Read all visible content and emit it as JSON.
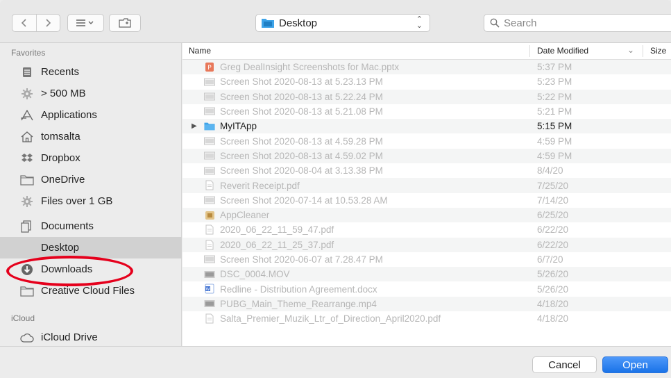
{
  "toolbar": {
    "location": "Desktop",
    "search_placeholder": "Search"
  },
  "sidebar": {
    "favorites_heading": "Favorites",
    "icloud_heading": "iCloud",
    "items": [
      {
        "label": "Recents",
        "icon": "recents-icon"
      },
      {
        "label": "> 500 MB",
        "icon": "gear-icon"
      },
      {
        "label": "Applications",
        "icon": "applications-icon"
      },
      {
        "label": "tomsalta",
        "icon": "home-icon"
      },
      {
        "label": "Dropbox",
        "icon": "dropbox-icon"
      },
      {
        "label": "OneDrive",
        "icon": "folder-icon"
      },
      {
        "label": "Files over 1 GB",
        "icon": "gear-icon"
      },
      {
        "label": "Documents",
        "icon": "documents-icon"
      },
      {
        "label": "Desktop",
        "icon": "desktop-icon"
      },
      {
        "label": "Downloads",
        "icon": "downloads-icon"
      },
      {
        "label": "Creative Cloud Files",
        "icon": "folder-icon"
      }
    ],
    "icloud_items": [
      {
        "label": "iCloud Drive",
        "icon": "cloud-icon"
      }
    ]
  },
  "columns": {
    "name": "Name",
    "date": "Date Modified",
    "size": "Size"
  },
  "files": [
    {
      "name": "Greg DealInsight Screenshots for Mac.pptx",
      "date": "5:37 PM",
      "icon": "pptx-icon"
    },
    {
      "name": "Screen Shot 2020-08-13 at 5.23.13 PM",
      "date": "5:23 PM",
      "icon": "image-icon"
    },
    {
      "name": "Screen Shot 2020-08-13 at 5.22.24 PM",
      "date": "5:22 PM",
      "icon": "image-icon"
    },
    {
      "name": "Screen Shot 2020-08-13 at 5.21.08 PM",
      "date": "5:21 PM",
      "icon": "image-icon"
    },
    {
      "name": "MyITApp",
      "date": "5:15 PM",
      "icon": "folder-icon"
    },
    {
      "name": "Screen Shot 2020-08-13 at 4.59.28 PM",
      "date": "4:59 PM",
      "icon": "image-icon"
    },
    {
      "name": "Screen Shot 2020-08-13 at 4.59.02 PM",
      "date": "4:59 PM",
      "icon": "image-icon"
    },
    {
      "name": "Screen Shot 2020-08-04 at 3.13.38 PM",
      "date": "8/4/20",
      "icon": "image-icon"
    },
    {
      "name": "Reverit Receipt.pdf",
      "date": "7/25/20",
      "icon": "pdf-icon"
    },
    {
      "name": "Screen Shot 2020-07-14 at 10.53.28 AM",
      "date": "7/14/20",
      "icon": "image-icon"
    },
    {
      "name": "AppCleaner",
      "date": "6/25/20",
      "icon": "app-icon"
    },
    {
      "name": "2020_06_22_11_59_47.pdf",
      "date": "6/22/20",
      "icon": "pdf-icon"
    },
    {
      "name": "2020_06_22_11_25_37.pdf",
      "date": "6/22/20",
      "icon": "pdf-icon"
    },
    {
      "name": "Screen Shot 2020-06-07 at 7.28.47 PM",
      "date": "6/7/20",
      "icon": "image-icon"
    },
    {
      "name": "DSC_0004.MOV",
      "date": "5/26/20",
      "icon": "movie-icon"
    },
    {
      "name": "Redline - Distribution Agreement.docx",
      "date": "5/26/20",
      "icon": "docx-icon"
    },
    {
      "name": "PUBG_Main_Theme_Rearrange.mp4",
      "date": "4/18/20",
      "icon": "movie-icon"
    },
    {
      "name": "Salta_Premier_Muzik_Ltr_of_Direction_April2020.pdf",
      "date": "4/18/20",
      "icon": "pdf-icon"
    }
  ],
  "buttons": {
    "cancel": "Cancel",
    "open": "Open"
  },
  "colors": {
    "accent": "#1a73e8",
    "folder": "#3da3e8",
    "annotation": "#e5001c"
  }
}
